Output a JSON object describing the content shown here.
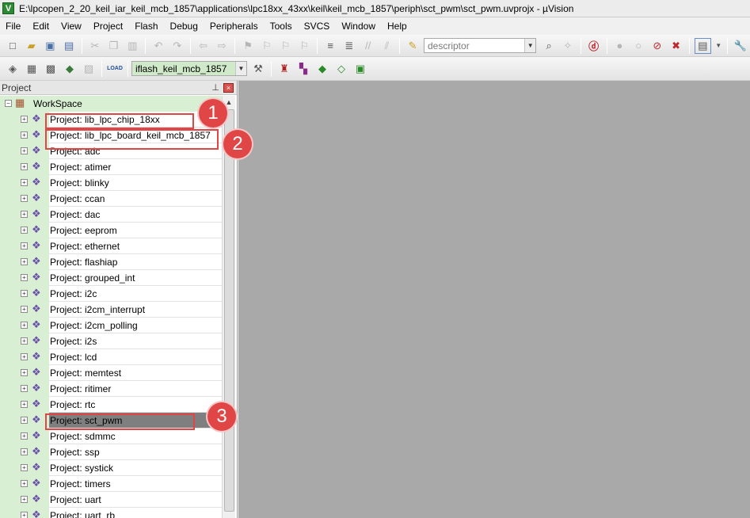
{
  "window": {
    "title": "E:\\lpcopen_2_20_keil_iar_keil_mcb_1857\\applications\\lpc18xx_43xx\\keil\\keil_mcb_1857\\periph\\sct_pwm\\sct_pwm.uvprojx - µVision",
    "app_icon_letter": "V"
  },
  "menu": [
    "File",
    "Edit",
    "View",
    "Project",
    "Flash",
    "Debug",
    "Peripherals",
    "Tools",
    "SVCS",
    "Window",
    "Help"
  ],
  "toolbar1": {
    "search_combo_value": "descriptor"
  },
  "toolbar2": {
    "target_combo_value": "iflash_keil_mcb_1857"
  },
  "project_panel": {
    "title": "Project",
    "workspace_label": "WorkSpace",
    "projects": [
      "Project: lib_lpc_chip_18xx",
      "Project: lib_lpc_board_keil_mcb_1857",
      "Project: adc",
      "Project: atimer",
      "Project: blinky",
      "Project: ccan",
      "Project: dac",
      "Project: eeprom",
      "Project: ethernet",
      "Project: flashiap",
      "Project: grouped_int",
      "Project: i2c",
      "Project: i2cm_interrupt",
      "Project: i2cm_polling",
      "Project: i2s",
      "Project: lcd",
      "Project: memtest",
      "Project: ritimer",
      "Project: rtc",
      "Project: sct_pwm",
      "Project: sdmmc",
      "Project: ssp",
      "Project: systick",
      "Project: timers",
      "Project: uart",
      "Project: uart_rb"
    ],
    "selected_project": "Project: sct_pwm"
  },
  "callouts": [
    "1",
    "2",
    "3"
  ],
  "colors": {
    "tree_bg": "#d9efd3",
    "workarea_bg": "#a9a9a9",
    "callout_red": "#e04646",
    "selected_row": "#7f7f7f"
  }
}
